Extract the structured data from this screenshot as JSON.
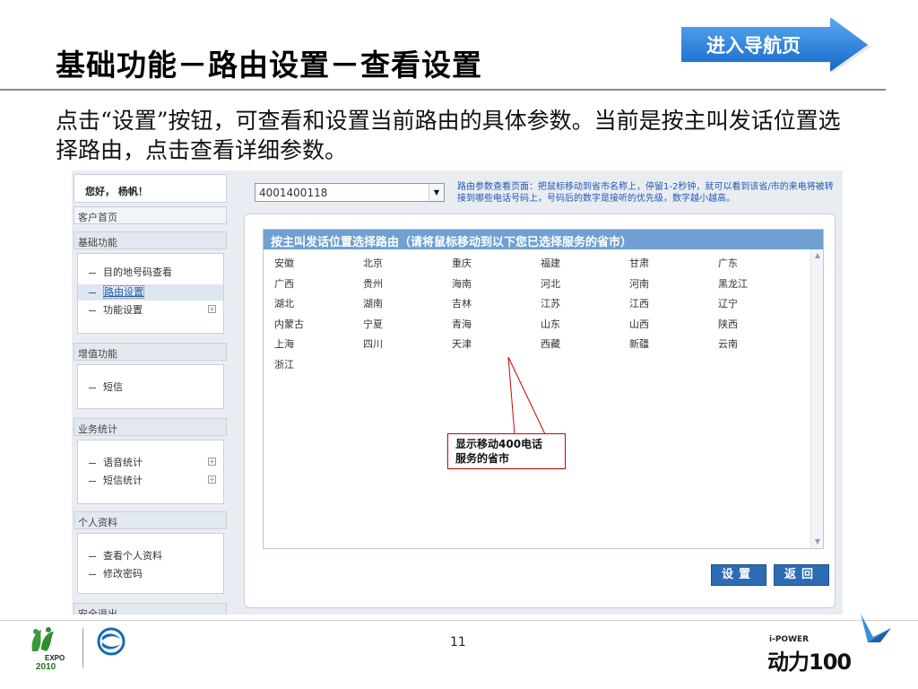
{
  "slide": {
    "title": "基础功能－路由设置－查看设置",
    "nav_button": "进入导航页",
    "description": "点击“设置”按钮，可查看和设置当前路由的具体参数。当前是按主叫发话位置选择路由，点击查看详细参数。",
    "page_number": "11",
    "callout": [
      "显示移动400电话",
      "服务的省市"
    ]
  },
  "colors": {
    "accent_blue": "#2d6cb3",
    "header_blue": "#6fa0d1",
    "hint_blue": "#1f58b5",
    "callout_red": "#d00000"
  },
  "sidebar": {
    "greeting": "您好， 杨帆！",
    "home": "客户首页",
    "sections": [
      {
        "title": "基础功能",
        "items": [
          {
            "label": "目的地号码查看",
            "expand": ""
          },
          {
            "label": "路由设置",
            "expand": ""
          },
          {
            "label": "功能设置",
            "expand": "+"
          }
        ]
      },
      {
        "title": "增值功能",
        "items": [
          {
            "label": "短信",
            "expand": ""
          }
        ]
      },
      {
        "title": "业务统计",
        "items": [
          {
            "label": "语音统计",
            "expand": "+"
          },
          {
            "label": "短信统计",
            "expand": "+"
          }
        ]
      },
      {
        "title": "个人资料",
        "items": [
          {
            "label": "查看个人资料",
            "expand": ""
          },
          {
            "label": "修改密码",
            "expand": ""
          }
        ]
      },
      {
        "title": "安全退出",
        "items": []
      }
    ]
  },
  "main": {
    "number_select": "4001400118",
    "hint": "路由参数查看页面：把鼠标移动到省市名称上，停留1-2秒钟，就可以看到该省/市的来电将被转接到哪些电话号码上，号码后的数字是接听的优先级，数字越小越高。",
    "panel_title": "按主叫发话位置选择路由（请将鼠标移动到以下您已选择服务的省市）",
    "provinces": [
      [
        "安徽",
        "北京",
        "重庆",
        "福建",
        "甘肃",
        "广东"
      ],
      [
        "广西",
        "贵州",
        "海南",
        "河北",
        "河南",
        "黑龙江"
      ],
      [
        "湖北",
        "湖南",
        "吉林",
        "江苏",
        "江西",
        "辽宁"
      ],
      [
        "内蒙古",
        "宁夏",
        "青海",
        "山东",
        "山西",
        "陕西"
      ],
      [
        "上海",
        "四川",
        "天津",
        "西藏",
        "新疆",
        "云南"
      ],
      [
        "浙江"
      ]
    ],
    "buttons": {
      "set": "设置",
      "back": "返回"
    }
  },
  "logos": {
    "expo": "EXPO 2010",
    "ipower_small": "i-POWER",
    "ipower_big": "动力100"
  }
}
